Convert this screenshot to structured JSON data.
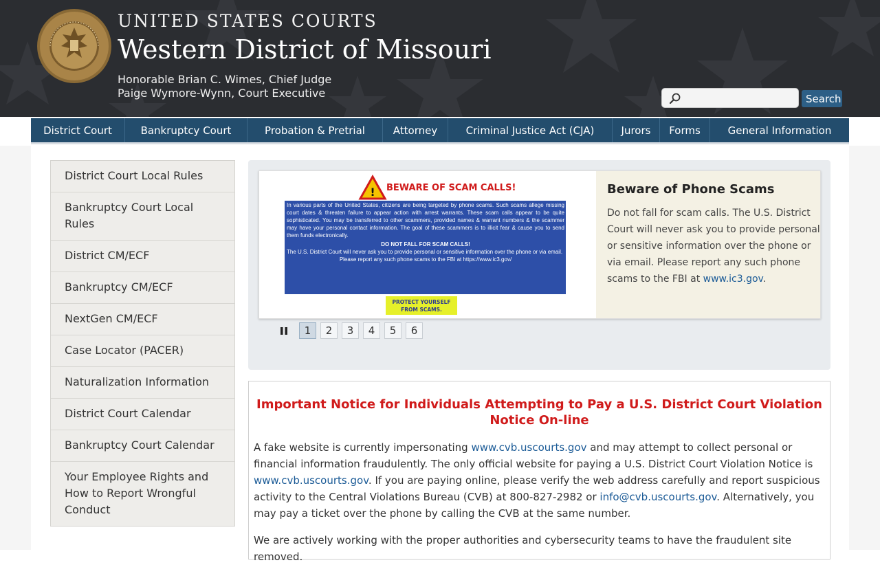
{
  "header": {
    "agency": "UNITED STATES COURTS",
    "district": "Western District of Missouri",
    "judge": "Honorable Brian C. Wimes, Chief Judge",
    "executive": "Paige Wymore-Wynn, Court Executive",
    "seal_text": "UNITED STATES COURTS WESTERN DISTRICT OF MISSOURI",
    "search_placeholder": "",
    "search_button": "Search",
    "search_icon": "magnifier-icon"
  },
  "nav": {
    "items": [
      {
        "label": "District Court"
      },
      {
        "label": "Bankruptcy Court"
      },
      {
        "label": "Probation & Pretrial"
      },
      {
        "label": "Attorney"
      },
      {
        "label": "Criminal Justice Act (CJA)"
      },
      {
        "label": "Jurors"
      },
      {
        "label": "Forms"
      },
      {
        "label": "General Information"
      }
    ]
  },
  "sidebar": {
    "items": [
      {
        "label": "District Court Local Rules"
      },
      {
        "label": "Bankruptcy Court Local Rules"
      },
      {
        "label": "District CM/ECF"
      },
      {
        "label": "Bankruptcy CM/ECF"
      },
      {
        "label": "NextGen CM/ECF"
      },
      {
        "label": "Case Locator (PACER)"
      },
      {
        "label": "Naturalization Information"
      },
      {
        "label": "District Court Calendar"
      },
      {
        "label": "Bankruptcy Court Calendar"
      },
      {
        "label": "Your Employee Rights and How to Report Wrongful Conduct"
      }
    ]
  },
  "slider": {
    "image": {
      "banner": "BEWARE OF SCAM CALLS!",
      "body1": "In various parts of the United States, citizens are being targeted by phone scams. Such scams allege missing court dates & threaten failure to appear action with arrest warrants. These scam calls appear to be quite sophisticated. You may be transferred to other scammers, provided names & warrant numbers & the scammer may have your personal contact information. The goal of these scammers is to illicit fear & cause you to send them funds electronically.",
      "heading": "DO NOT FALL FOR SCAM CALLS!",
      "body2": "The U.S. District Court will never ask you to provide personal or sensitive information over the phone or via email.",
      "body3": "Please report any such phone scams to the FBI at https://www.ic3.gov/",
      "protect1": "PROTECT YOURSELF",
      "protect2": "FROM SCAMS."
    },
    "title": "Beware of Phone Scams",
    "text": "Do not fall for scam calls. The U.S. District Court will never ask you to provide personal or sensitive information over the phone or via email. Please report any such phone scams to the FBI at ",
    "link": "www.ic3.gov",
    "link_suffix": ".",
    "pages": [
      "1",
      "2",
      "3",
      "4",
      "5",
      "6"
    ],
    "active_page": "1",
    "pause_icon": "pause-icon"
  },
  "notice": {
    "title": "Important Notice for Individuals Attempting to Pay a U.S. District Court Violation Notice On-line",
    "p1_a": "A fake website is currently impersonating ",
    "p1_link1": "www.cvb.uscourts.gov",
    "p1_b": " and may attempt to collect personal or financial information fraudulently. The only official website for paying a U.S. District Court Violation Notice is ",
    "p1_link2": "www.cvb.uscourts.gov",
    "p1_c": ". If you are paying online, please verify the web address carefully and report suspicious activity to the Central Violations Bureau (CVB) at 800-827-2982 or ",
    "p1_link3": "info@cvb.uscourts.gov",
    "p1_d": ". Alternatively, you may pay a ticket over the phone by calling the CVB at the same number.",
    "p2": "We are actively working with the proper authorities and cybersecurity teams to have the fraudulent site removed."
  },
  "colors": {
    "header_bg": "#2b2d31",
    "nav_bg": "#234d6d",
    "search_button": "#2d5f86",
    "notice_title": "#d01b1b",
    "link": "#1a5a96",
    "slide_text_bg": "#f4f1e4",
    "scam_panel": "#2d4fa8",
    "protect_badge": "#e6f02a"
  }
}
